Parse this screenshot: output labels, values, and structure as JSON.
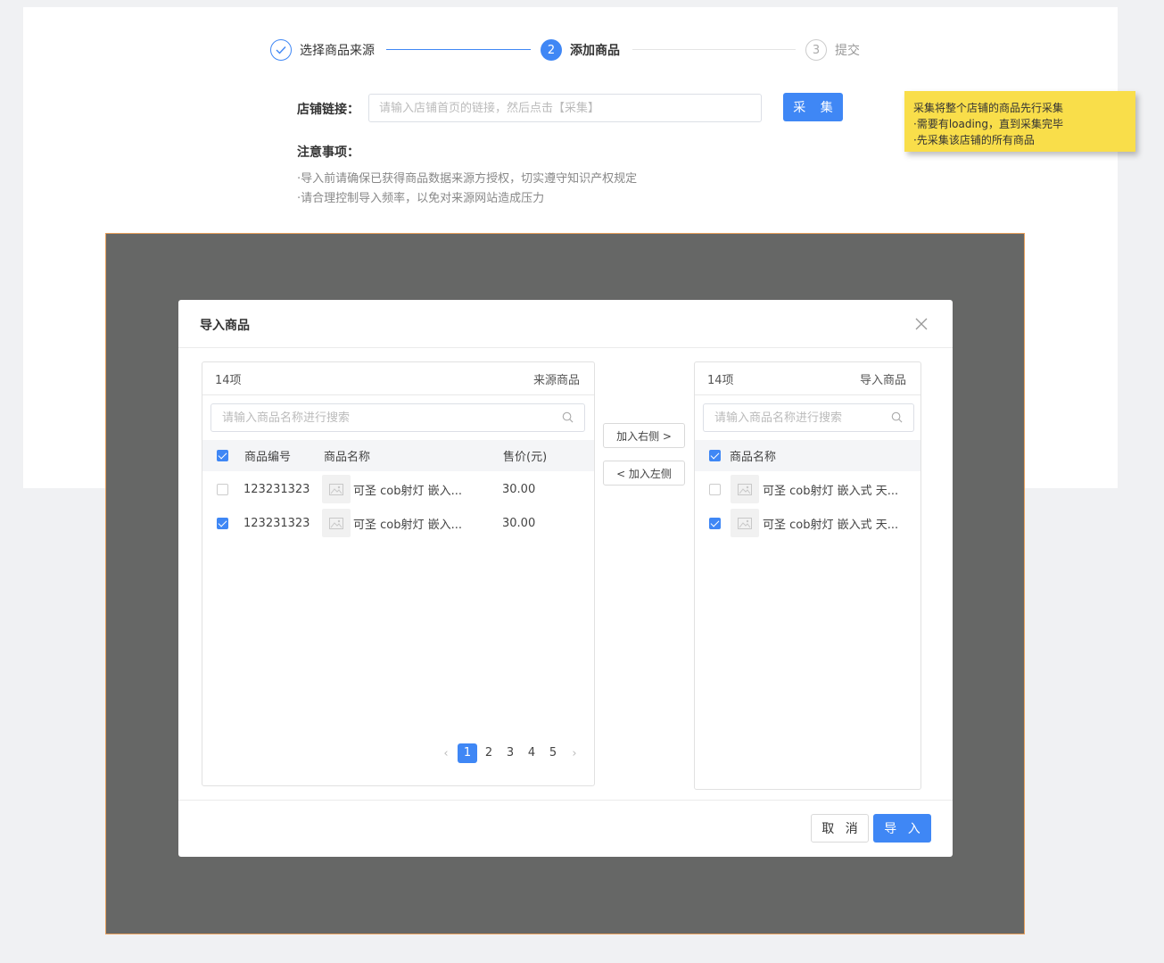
{
  "steps": [
    {
      "label": "选择商品来源",
      "state": "done",
      "icon": "check-icon"
    },
    {
      "label": "添加商品",
      "state": "active",
      "number": "2"
    },
    {
      "label": "提交",
      "state": "pending",
      "number": "3"
    }
  ],
  "store": {
    "label": "店铺链接：",
    "placeholder": "请输入店铺首页的链接，然后点击【采集】",
    "value": "",
    "collect_label": "采 集"
  },
  "notice": {
    "title": "注意事项：",
    "lines": [
      "·导入前请确保已获得商品数据来源方授权，切实遵守知识产权规定",
      "·请合理控制导入频率，以免对来源网站造成压力"
    ]
  },
  "sticky_note": {
    "lines": [
      "采集将整个店铺的商品先行采集",
      "·需要有loading，直到采集完毕",
      "·先采集该店铺的所有商品"
    ]
  },
  "modal": {
    "title": "导入商品",
    "close_icon": "close-icon",
    "transfer": {
      "to_right": "加入右侧 >",
      "to_left": "< 加入左侧"
    },
    "cancel_label": "取 消",
    "import_label": "导 入",
    "left": {
      "count": "14项",
      "title": "来源商品",
      "search_placeholder": "请输入商品名称进行搜索",
      "columns": [
        "商品编号",
        "商品名称",
        "售价(元)"
      ],
      "header_checked": true,
      "rows": [
        {
          "checked": false,
          "code": "123231323",
          "name": "可圣 cob射灯 嵌入...",
          "price": "30.00"
        },
        {
          "checked": true,
          "code": "123231323",
          "name": "可圣 cob射灯 嵌入...",
          "price": "30.00"
        }
      ],
      "pagination": {
        "pages": [
          "1",
          "2",
          "3",
          "4",
          "5"
        ],
        "current": "1"
      }
    },
    "right": {
      "count": "14项",
      "title": "导入商品",
      "search_placeholder": "请输入商品名称进行搜索",
      "columns": [
        "商品名称"
      ],
      "header_checked": true,
      "rows": [
        {
          "checked": false,
          "name": "可圣 cob射灯 嵌入式 天..."
        },
        {
          "checked": true,
          "name": "可圣 cob射灯 嵌入式 天..."
        }
      ]
    }
  },
  "colors": {
    "primary": "#3f87f5",
    "overlay": "#666766",
    "sticky": "#f9de4a"
  }
}
